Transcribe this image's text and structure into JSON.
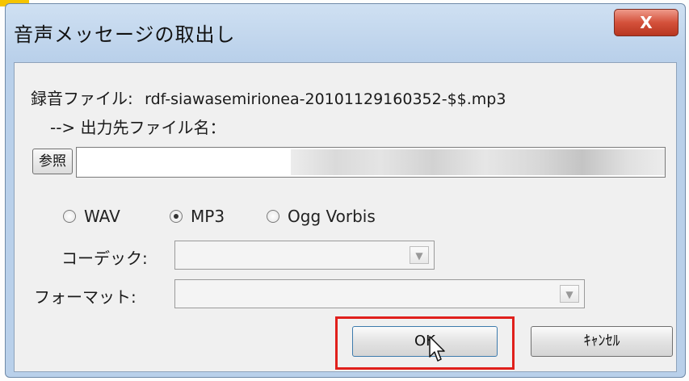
{
  "window": {
    "title": "音声メッセージの取出し",
    "close_label": "X"
  },
  "recording": {
    "label": "録音ファイル:",
    "filename": "rdf-siawasemirionea-20101129160352-$$.mp3"
  },
  "output": {
    "label": "--> 出力先ファイル名：",
    "browse_label": "参照",
    "path_value": ""
  },
  "format": {
    "options": [
      {
        "label": "WAV",
        "checked": false
      },
      {
        "label": "MP3",
        "checked": true
      },
      {
        "label": "Ogg Vorbis",
        "checked": false
      }
    ]
  },
  "codec": {
    "label": "コーデック:",
    "value": ""
  },
  "file_format": {
    "label": "フォーマット:",
    "value": ""
  },
  "buttons": {
    "ok_label": "OK",
    "cancel_label": "ｷｬﾝｾﾙ"
  },
  "colors": {
    "highlight": "#e0201c",
    "title_bar": "#b9d0ea"
  },
  "icons": {
    "cursor": "mouse-pointer-icon",
    "close": "close-icon",
    "dropdown": "chevron-down-icon"
  }
}
